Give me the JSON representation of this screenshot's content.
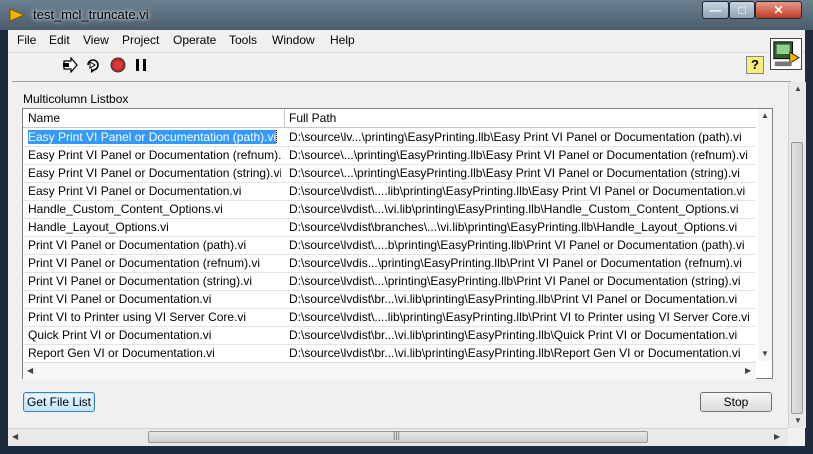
{
  "window": {
    "title": "test_mcl_truncate.vi"
  },
  "menu": [
    "File",
    "Edit",
    "View",
    "Project",
    "Operate",
    "Tools",
    "Window",
    "Help"
  ],
  "toolbar": {
    "help_label": "?"
  },
  "listbox": {
    "label": "Multicolumn Listbox",
    "headers": [
      "Name",
      "Full Path"
    ],
    "selected_row": 0,
    "rows": [
      [
        "Easy Print VI Panel or Documentation (path).vi",
        "D:\\source\\lv...\\printing\\EasyPrinting.llb\\Easy Print VI Panel or Documentation (path).vi"
      ],
      [
        "Easy Print VI Panel or Documentation (refnum).vi",
        "D:\\source\\...\\printing\\EasyPrinting.llb\\Easy Print VI Panel or Documentation (refnum).vi"
      ],
      [
        "Easy Print VI Panel or Documentation (string).vi",
        "D:\\source\\...\\printing\\EasyPrinting.llb\\Easy Print VI Panel or Documentation (string).vi"
      ],
      [
        "Easy Print VI Panel or Documentation.vi",
        "D:\\source\\lvdist\\....lib\\printing\\EasyPrinting.llb\\Easy Print VI Panel or Documentation.vi"
      ],
      [
        "Handle_Custom_Content_Options.vi",
        "D:\\source\\lvdist\\...\\vi.lib\\printing\\EasyPrinting.llb\\Handle_Custom_Content_Options.vi"
      ],
      [
        "Handle_Layout_Options.vi",
        "D:\\source\\lvdist\\branches\\...\\vi.lib\\printing\\EasyPrinting.llb\\Handle_Layout_Options.vi"
      ],
      [
        "Print VI Panel or Documentation (path).vi",
        "D:\\source\\lvdist\\....b\\printing\\EasyPrinting.llb\\Print VI Panel or Documentation (path).vi"
      ],
      [
        "Print VI Panel or Documentation (refnum).vi",
        "D:\\source\\lvdis...\\printing\\EasyPrinting.llb\\Print VI Panel or Documentation (refnum).vi"
      ],
      [
        "Print VI Panel or Documentation (string).vi",
        "D:\\source\\lvdist\\...\\printing\\EasyPrinting.llb\\Print VI Panel or Documentation (string).vi"
      ],
      [
        "Print VI Panel or Documentation.vi",
        "D:\\source\\lvdist\\br...\\vi.lib\\printing\\EasyPrinting.llb\\Print VI Panel or Documentation.vi"
      ],
      [
        "Print VI to Printer using VI Server Core.vi",
        "D:\\source\\lvdist\\....lib\\printing\\EasyPrinting.llb\\Print VI to Printer using VI Server Core.vi"
      ],
      [
        "Quick Print VI or Documentation.vi",
        "D:\\source\\lvdist\\br...\\vi.lib\\printing\\EasyPrinting.llb\\Quick Print VI or Documentation.vi"
      ],
      [
        "Report Gen VI or Documentation.vi",
        "D:\\source\\lvdist\\br...\\vi.lib\\printing\\EasyPrinting.llb\\Report Gen VI or Documentation.vi"
      ]
    ]
  },
  "buttons": {
    "get_file_list": "Get File List",
    "stop": "Stop"
  }
}
